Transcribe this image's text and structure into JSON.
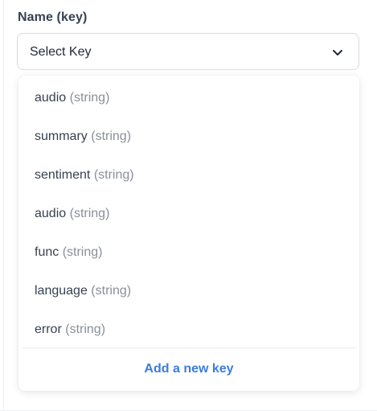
{
  "field": {
    "label": "Name (key)"
  },
  "select": {
    "value": "Select Key",
    "icon": "chevron-down-icon"
  },
  "dropdown": {
    "options": [
      {
        "name": "audio",
        "type": "(string)"
      },
      {
        "name": "summary",
        "type": "(string)"
      },
      {
        "name": "sentiment",
        "type": "(string)"
      },
      {
        "name": "audio",
        "type": "(string)"
      },
      {
        "name": "func",
        "type": "(string)"
      },
      {
        "name": "language",
        "type": "(string)"
      },
      {
        "name": "error",
        "type": "(string)"
      }
    ],
    "add_label": "Add a new key"
  },
  "colors": {
    "link": "#3b7ddd",
    "muted": "#8a9099",
    "border": "#d7dbe0"
  }
}
